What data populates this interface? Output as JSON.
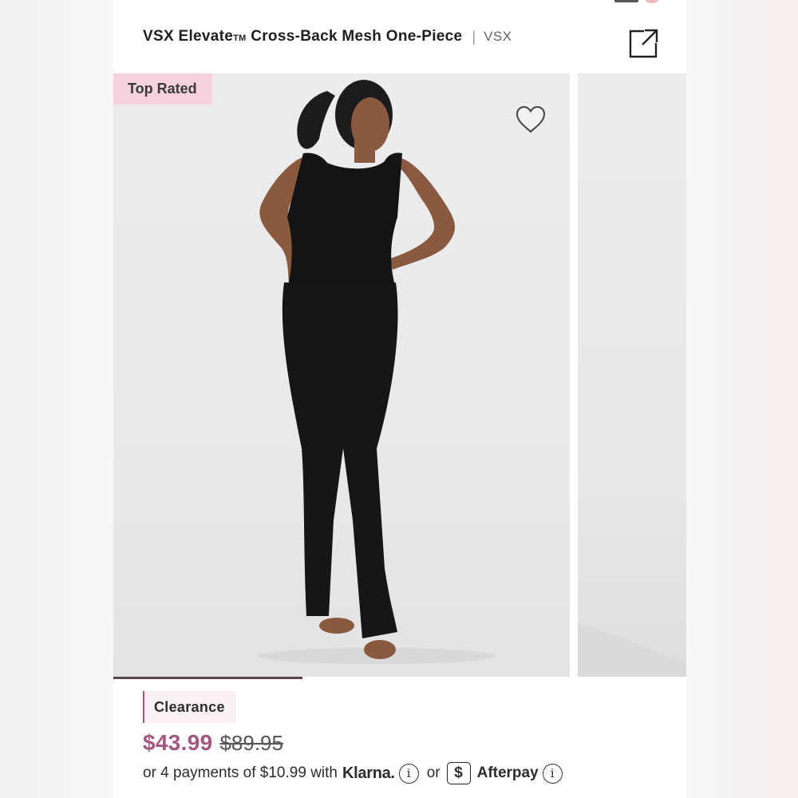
{
  "product": {
    "name_main": "VSX Elevate",
    "name_tm": "TM",
    "name_rest": " Cross-Back Mesh One-Piece",
    "separator": "|",
    "brand": "VSX"
  },
  "gallery": {
    "badge": "Top Rated",
    "current_image": 1,
    "progress": 0.33
  },
  "pricing": {
    "tag": "Clearance",
    "sale_price": "$43.99",
    "original_price": "$89.95",
    "installments_text": "or 4 payments of $10.99 with",
    "klarna_label": "Klarna.",
    "or_text": "or",
    "afterpay_symbol": "$",
    "afterpay_label": "Afterpay",
    "info_symbol": "i"
  },
  "icons": {
    "share": "share-icon",
    "favorite": "heart-icon",
    "info": "info-icon"
  },
  "colors": {
    "accent_price": "#a4577f",
    "badge_bg": "#f6d3dc",
    "progress": "#5a4450"
  }
}
